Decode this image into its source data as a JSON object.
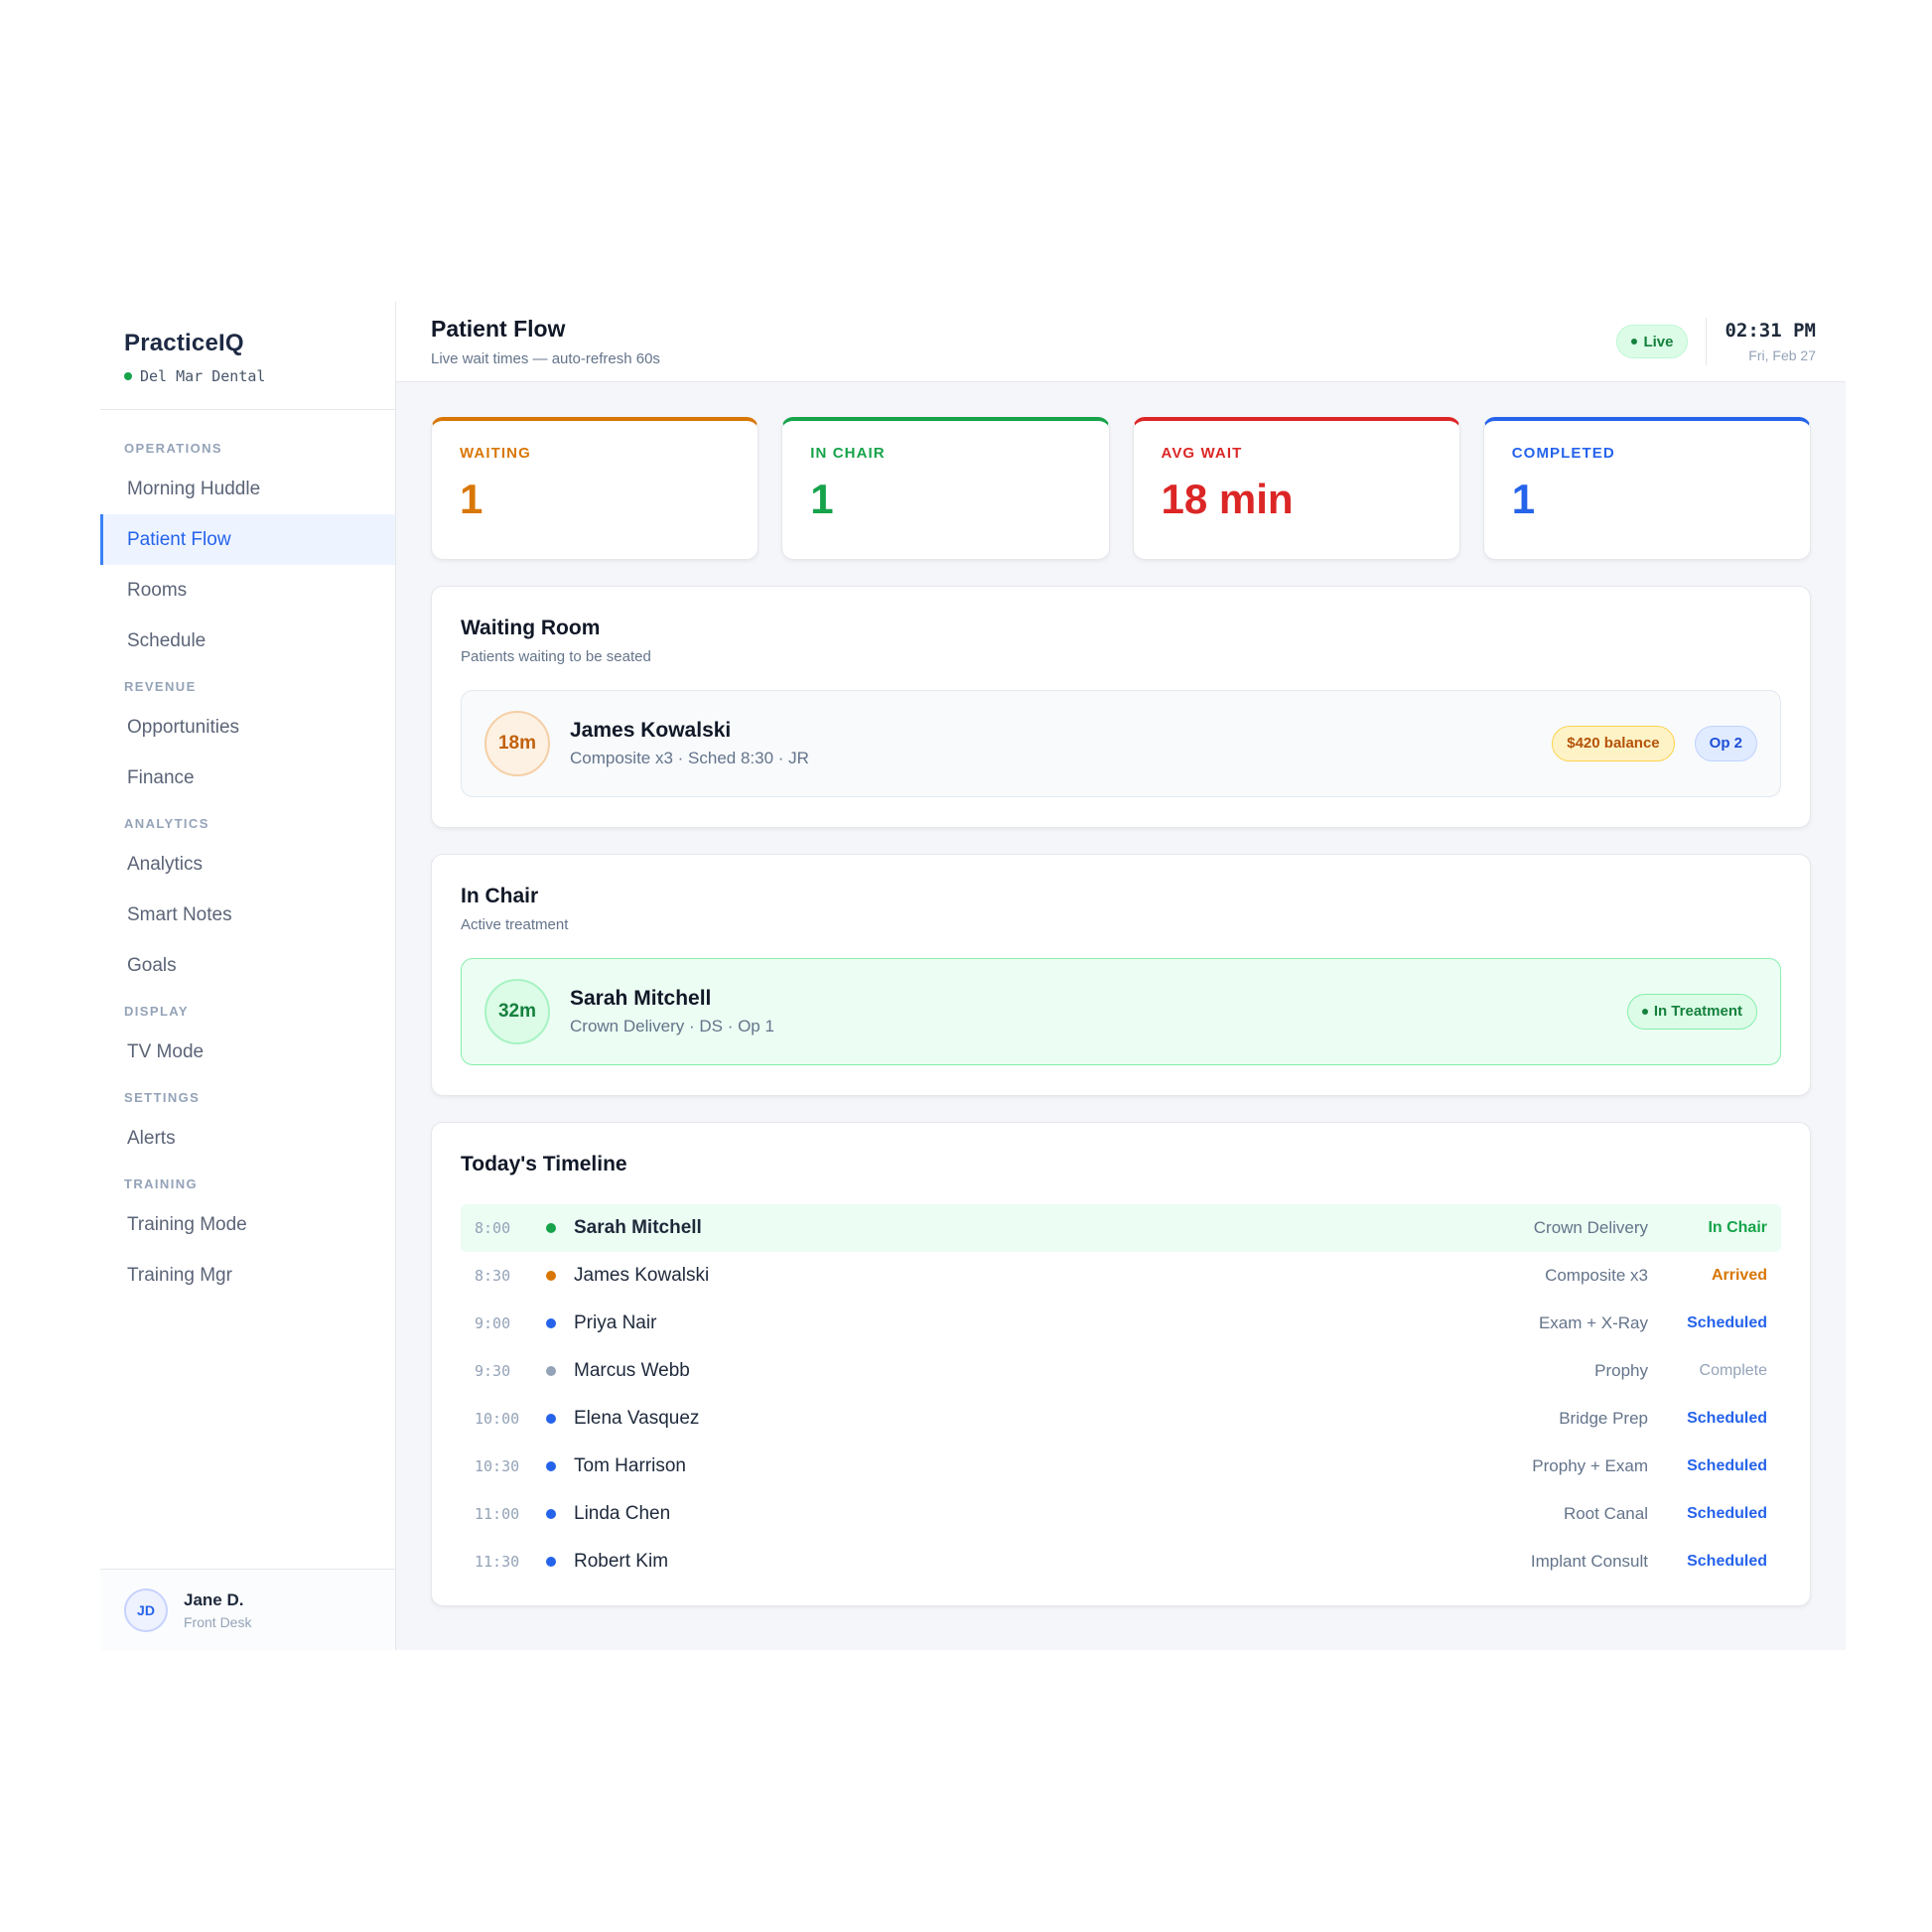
{
  "brand": {
    "name": "PracticeIQ",
    "location": "Del Mar Dental",
    "status_color": "#16a34a"
  },
  "nav": {
    "sections": [
      {
        "title": "OPERATIONS",
        "items": [
          {
            "label": "Morning Huddle",
            "active": false
          },
          {
            "label": "Patient Flow",
            "active": true
          },
          {
            "label": "Rooms",
            "active": false
          },
          {
            "label": "Schedule",
            "active": false
          }
        ]
      },
      {
        "title": "REVENUE",
        "items": [
          {
            "label": "Opportunities",
            "active": false
          },
          {
            "label": "Finance",
            "active": false
          }
        ]
      },
      {
        "title": "ANALYTICS",
        "items": [
          {
            "label": "Analytics",
            "active": false
          },
          {
            "label": "Smart Notes",
            "active": false
          },
          {
            "label": "Goals",
            "active": false
          }
        ]
      },
      {
        "title": "DISPLAY",
        "items": [
          {
            "label": "TV Mode",
            "active": false
          }
        ]
      },
      {
        "title": "SETTINGS",
        "items": [
          {
            "label": "Alerts",
            "active": false
          }
        ]
      },
      {
        "title": "TRAINING",
        "items": [
          {
            "label": "Training Mode",
            "active": false
          },
          {
            "label": "Training Mgr",
            "active": false
          }
        ]
      }
    ]
  },
  "user": {
    "initials": "JD",
    "name": "Jane D.",
    "role": "Front Desk"
  },
  "header": {
    "title": "Patient Flow",
    "subtitle": "Live wait times — auto-refresh 60s",
    "live_label": "Live",
    "time": "02:31 PM",
    "date": "Fri, Feb 27"
  },
  "stats": [
    {
      "label": "WAITING",
      "value": "1",
      "color": "#d97706"
    },
    {
      "label": "IN CHAIR",
      "value": "1",
      "color": "#16a34a"
    },
    {
      "label": "AVG WAIT",
      "value": "18 min",
      "color": "#dc2626"
    },
    {
      "label": "COMPLETED",
      "value": "1",
      "color": "#2563eb"
    }
  ],
  "waiting_room": {
    "title": "Waiting Room",
    "subtitle": "Patients waiting to be seated",
    "patient": {
      "timer": "18m",
      "name": "James Kowalski",
      "detail": "Composite x3 · Sched 8:30 · JR",
      "balance_badge": "$420 balance",
      "room_badge": "Op 2"
    }
  },
  "in_chair": {
    "title": "In Chair",
    "subtitle": "Active treatment",
    "patient": {
      "timer": "32m",
      "name": "Sarah Mitchell",
      "detail": "Crown Delivery · DS · Op 1",
      "status_badge": "In Treatment"
    }
  },
  "timeline": {
    "title": "Today's Timeline",
    "rows": [
      {
        "time": "8:00",
        "name": "Sarah Mitchell",
        "procedure": "Crown Delivery",
        "status": "In Chair",
        "dot_color": "#16a34a",
        "status_color": "#16a34a",
        "highlight": true
      },
      {
        "time": "8:30",
        "name": "James Kowalski",
        "procedure": "Composite x3",
        "status": "Arrived",
        "dot_color": "#d97706",
        "status_color": "#d97706",
        "highlight": false
      },
      {
        "time": "9:00",
        "name": "Priya Nair",
        "procedure": "Exam + X-Ray",
        "status": "Scheduled",
        "dot_color": "#2563eb",
        "status_color": "#2563eb",
        "highlight": false
      },
      {
        "time": "9:30",
        "name": "Marcus Webb",
        "procedure": "Prophy",
        "status": "Complete",
        "dot_color": "#94a3b8",
        "status_color": "#94a3b8",
        "highlight": false
      },
      {
        "time": "10:00",
        "name": "Elena Vasquez",
        "procedure": "Bridge Prep",
        "status": "Scheduled",
        "dot_color": "#2563eb",
        "status_color": "#2563eb",
        "highlight": false
      },
      {
        "time": "10:30",
        "name": "Tom Harrison",
        "procedure": "Prophy + Exam",
        "status": "Scheduled",
        "dot_color": "#2563eb",
        "status_color": "#2563eb",
        "highlight": false
      },
      {
        "time": "11:00",
        "name": "Linda Chen",
        "procedure": "Root Canal",
        "status": "Scheduled",
        "dot_color": "#2563eb",
        "status_color": "#2563eb",
        "highlight": false
      },
      {
        "time": "11:30",
        "name": "Robert Kim",
        "procedure": "Implant Consult",
        "status": "Scheduled",
        "dot_color": "#2563eb",
        "status_color": "#2563eb",
        "highlight": false
      }
    ]
  }
}
